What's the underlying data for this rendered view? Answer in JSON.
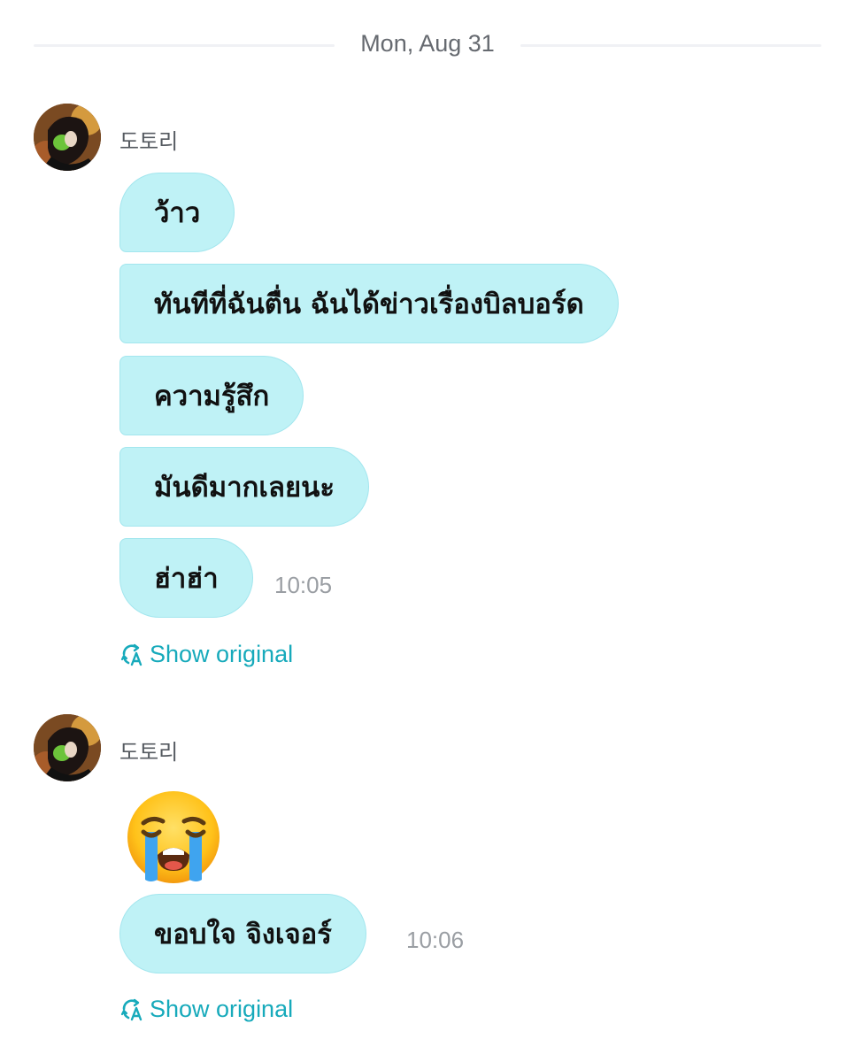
{
  "date_divider": "Mon, Aug 31",
  "groups": [
    {
      "sender": "도토리",
      "messages": [
        "ว้าว",
        "ทันทีที่ฉันตื่น ฉันได้ข่าวเรื่องบิลบอร์ด",
        "ความรู้สึก",
        "มันดีมากเลยนะ",
        "ฮ่าฮ่า"
      ],
      "time": "10:05",
      "show_original": "Show original"
    },
    {
      "sender": "도토리",
      "emoji": "loudly-crying-face",
      "messages": [
        "ขอบใจ จิงเจอร์"
      ],
      "time": "10:06",
      "show_original": "Show original"
    }
  ],
  "colors": {
    "bubble": "#bff2f6",
    "bubble_border": "#a3e6ee",
    "link": "#17aabb",
    "timestamp": "#9a9ea3"
  }
}
